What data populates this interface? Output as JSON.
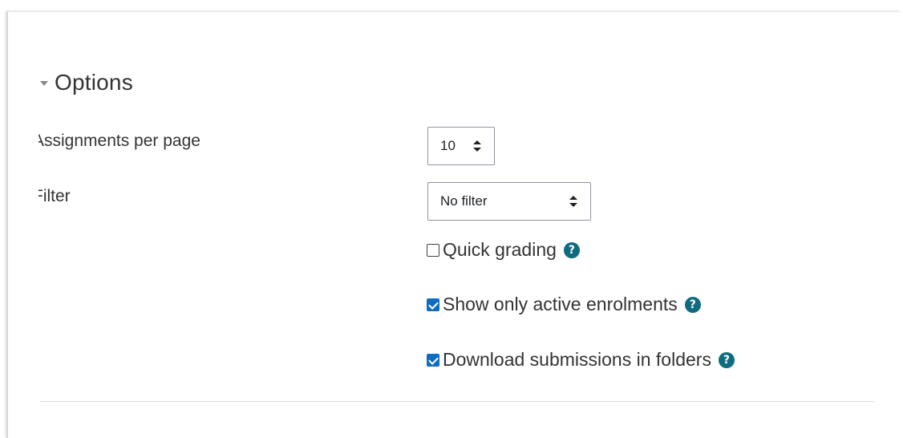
{
  "options": {
    "title": "Options",
    "assignments_per_page": {
      "label": "Assignments per page",
      "value": "10"
    },
    "filter": {
      "label": "Filter",
      "value": "No filter"
    },
    "checkboxes": [
      {
        "label": "Quick grading",
        "checked": false
      },
      {
        "label": "Show only active enrolments",
        "checked": true
      },
      {
        "label": "Download submissions in folders",
        "checked": true
      }
    ],
    "help_symbol": "?"
  },
  "colors": {
    "checkbox_accent": "#0f6cbf",
    "help_icon": "#0f6b7f"
  }
}
